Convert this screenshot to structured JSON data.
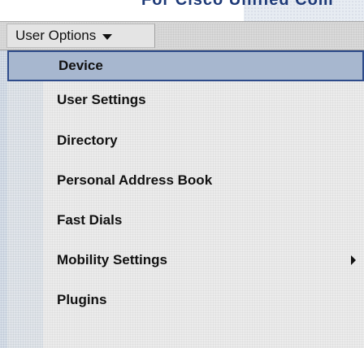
{
  "banner": {
    "text": "For Cisco Unified Com"
  },
  "menubar": {
    "button_label": "User Options",
    "button_icon": "chevron-down-icon"
  },
  "dropdown": {
    "items": [
      {
        "label": "Device",
        "selected": true,
        "has_submenu": false
      },
      {
        "label": "User Settings",
        "selected": false,
        "has_submenu": false
      },
      {
        "label": "Directory",
        "selected": false,
        "has_submenu": false
      },
      {
        "label": "Personal Address Book",
        "selected": false,
        "has_submenu": false
      },
      {
        "label": "Fast Dials",
        "selected": false,
        "has_submenu": false
      },
      {
        "label": "Mobility Settings",
        "selected": false,
        "has_submenu": true
      },
      {
        "label": "Plugins",
        "selected": false,
        "has_submenu": false
      }
    ],
    "submenu_icon": "caret-right-icon"
  },
  "colors": {
    "selected_fill": "#a7b7cf",
    "selected_border": "#2e4b8a",
    "banner_text": "#1e3a78"
  }
}
